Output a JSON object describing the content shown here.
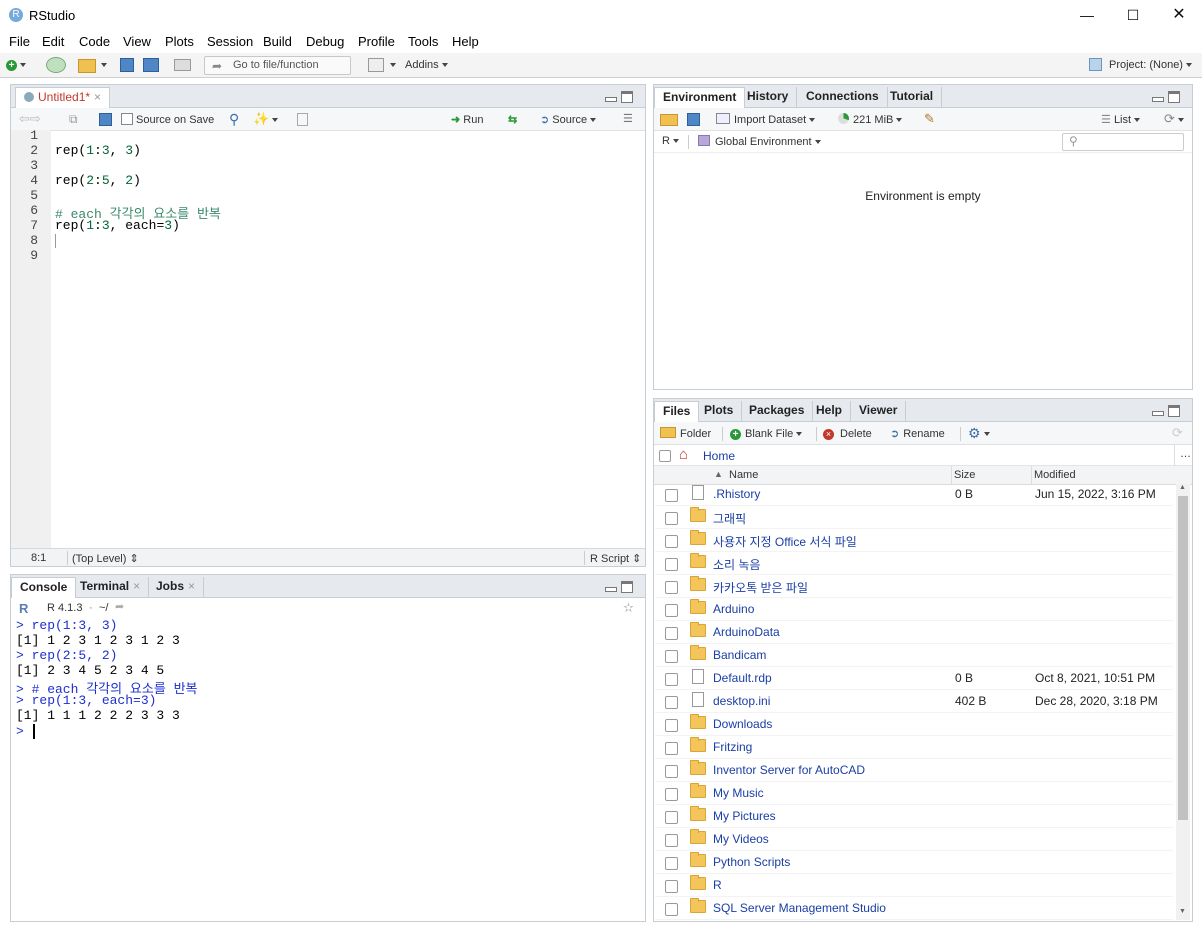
{
  "window": {
    "title": "RStudio"
  },
  "menu": [
    "File",
    "Edit",
    "Code",
    "View",
    "Plots",
    "Session",
    "Build",
    "Debug",
    "Profile",
    "Tools",
    "Help"
  ],
  "toolbar": {
    "goto_placeholder": "Go to file/function",
    "addins": "Addins",
    "project": "Project: (None)"
  },
  "editor": {
    "tab": "Untitled1*",
    "source_on_save": "Source on Save",
    "run": "Run",
    "source": "Source",
    "line_numbers": [
      "1",
      "2",
      "3",
      "4",
      "5",
      "6",
      "7",
      "8",
      "9"
    ],
    "status_pos": "8:1",
    "status_scope": "(Top Level)",
    "status_type": "R Script"
  },
  "console": {
    "tabs": [
      "Console",
      "Terminal",
      "Jobs"
    ],
    "r_version": "R 4.1.3",
    "path": "~/",
    "lines": [
      {
        "text": "> rep(1:3, 3)",
        "kind": "in"
      },
      {
        "text": "[1] 1 2 3 1 2 3 1 2 3",
        "kind": "out"
      },
      {
        "text": "> rep(2:5, 2)",
        "kind": "in"
      },
      {
        "text": "[1] 2 3 4 5 2 3 4 5",
        "kind": "out"
      },
      {
        "text": "> # each 각각의 요소를 반복",
        "kind": "in"
      },
      {
        "text": "> rep(1:3, each=3)",
        "kind": "in"
      },
      {
        "text": "[1] 1 1 1 2 2 2 3 3 3",
        "kind": "out"
      },
      {
        "text": "> ",
        "kind": "in"
      }
    ]
  },
  "environment": {
    "tabs": [
      "Environment",
      "History",
      "Connections",
      "Tutorial"
    ],
    "import_dataset": "Import Dataset",
    "memory": "221 MiB",
    "view_mode": "List",
    "lang": "R",
    "scope": "Global Environment",
    "empty_message": "Environment is empty"
  },
  "files": {
    "tabs": [
      "Files",
      "Plots",
      "Packages",
      "Help",
      "Viewer"
    ],
    "actions": {
      "folder": "Folder",
      "blank_file": "Blank File",
      "delete": "Delete",
      "rename": "Rename"
    },
    "breadcrumb": "Home",
    "more": "…",
    "columns": {
      "name": "Name",
      "size": "Size",
      "modified": "Modified"
    },
    "rows": [
      {
        "name": ".Rhistory",
        "size": "0 B",
        "modified": "Jun 15, 2022, 3:16 PM",
        "type": "file-history"
      },
      {
        "name": "그래픽",
        "size": "",
        "modified": "",
        "type": "folder"
      },
      {
        "name": "사용자 지정 Office 서식 파일",
        "size": "",
        "modified": "",
        "type": "folder"
      },
      {
        "name": "소리 녹음",
        "size": "",
        "modified": "",
        "type": "folder"
      },
      {
        "name": "카카오톡 받은 파일",
        "size": "",
        "modified": "",
        "type": "folder"
      },
      {
        "name": "Arduino",
        "size": "",
        "modified": "",
        "type": "folder"
      },
      {
        "name": "ArduinoData",
        "size": "",
        "modified": "",
        "type": "folder"
      },
      {
        "name": "Bandicam",
        "size": "",
        "modified": "",
        "type": "folder"
      },
      {
        "name": "Default.rdp",
        "size": "0 B",
        "modified": "Oct 8, 2021, 10:51 PM",
        "type": "file"
      },
      {
        "name": "desktop.ini",
        "size": "402 B",
        "modified": "Dec 28, 2020, 3:18 PM",
        "type": "file-settings"
      },
      {
        "name": "Downloads",
        "size": "",
        "modified": "",
        "type": "folder"
      },
      {
        "name": "Fritzing",
        "size": "",
        "modified": "",
        "type": "folder"
      },
      {
        "name": "Inventor Server for AutoCAD",
        "size": "",
        "modified": "",
        "type": "folder"
      },
      {
        "name": "My Music",
        "size": "",
        "modified": "",
        "type": "folder"
      },
      {
        "name": "My Pictures",
        "size": "",
        "modified": "",
        "type": "folder"
      },
      {
        "name": "My Videos",
        "size": "",
        "modified": "",
        "type": "folder"
      },
      {
        "name": "Python Scripts",
        "size": "",
        "modified": "",
        "type": "folder"
      },
      {
        "name": "R",
        "size": "",
        "modified": "",
        "type": "folder"
      },
      {
        "name": "SQL Server Management Studio",
        "size": "",
        "modified": "",
        "type": "folder"
      }
    ]
  }
}
